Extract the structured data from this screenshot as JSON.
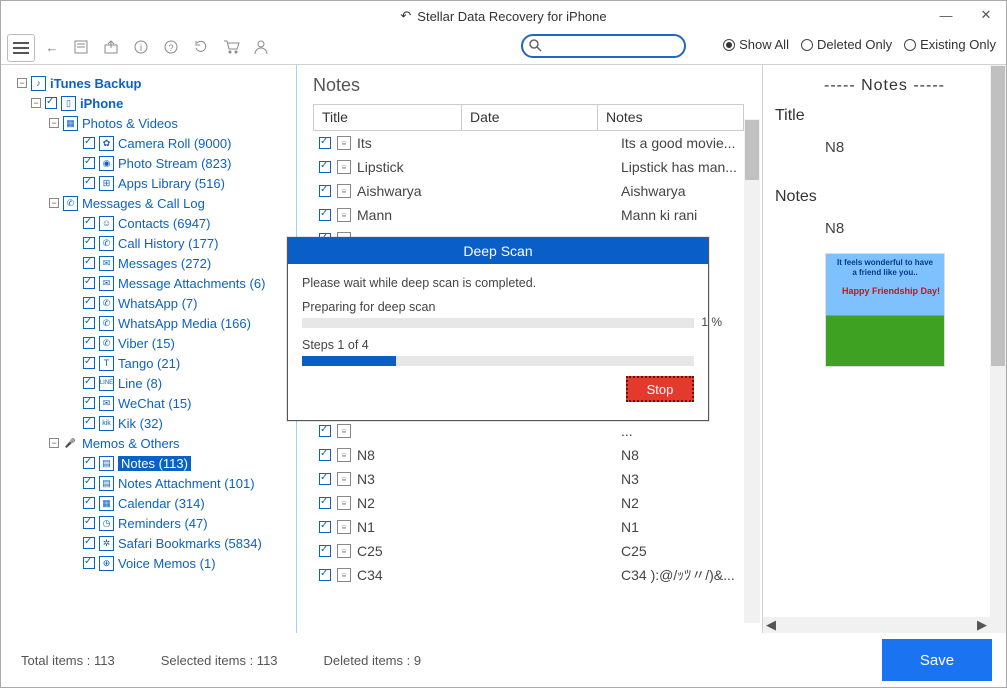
{
  "window": {
    "title": "Stellar Data Recovery for iPhone"
  },
  "filter": {
    "show_all": "Show All",
    "deleted_only": "Deleted Only",
    "existing_only": "Existing Only"
  },
  "tree": {
    "root": "iTunes Backup",
    "device": "iPhone",
    "groups": [
      {
        "label": "Photos & Videos",
        "children": [
          {
            "label": "Camera Roll (9000)"
          },
          {
            "label": "Photo Stream (823)"
          },
          {
            "label": "Apps Library (516)"
          }
        ]
      },
      {
        "label": "Messages & Call Log",
        "children": [
          {
            "label": "Contacts (6947)"
          },
          {
            "label": "Call History (177)"
          },
          {
            "label": "Messages (272)"
          },
          {
            "label": "Message Attachments (6)"
          },
          {
            "label": "WhatsApp (7)"
          },
          {
            "label": "WhatsApp Media (166)"
          },
          {
            "label": "Viber (15)"
          },
          {
            "label": "Tango (21)"
          },
          {
            "label": "Line (8)"
          },
          {
            "label": "WeChat (15)"
          },
          {
            "label": "Kik (32)"
          }
        ]
      },
      {
        "label": "Memos & Others",
        "children": [
          {
            "label": "Notes (113)",
            "selected": true
          },
          {
            "label": "Notes Attachment (101)"
          },
          {
            "label": "Calendar (314)"
          },
          {
            "label": "Reminders (47)"
          },
          {
            "label": "Safari Bookmarks (5834)"
          },
          {
            "label": "Voice Memos (1)"
          }
        ]
      }
    ]
  },
  "center": {
    "heading": "Notes",
    "columns": {
      "title": "Title",
      "date": "Date",
      "notes": "Notes"
    },
    "rows": [
      {
        "title": "Its",
        "date": "",
        "notes": "Its a good movie..."
      },
      {
        "title": "Lipstick",
        "date": "",
        "notes": "Lipstick has man..."
      },
      {
        "title": "Aishwarya",
        "date": "",
        "notes": "Aishwarya"
      },
      {
        "title": "Mann",
        "date": "",
        "notes": "Mann ki rani"
      },
      {
        "title": "",
        "date": "",
        "notes": ""
      },
      {
        "title": "",
        "date": "",
        "notes": ""
      },
      {
        "title": "",
        "date": "",
        "notes": ""
      },
      {
        "title": "",
        "date": "",
        "notes": ""
      },
      {
        "title": "",
        "date": "",
        "notes": "."
      },
      {
        "title": "",
        "date": "",
        "notes": ")..."
      },
      {
        "title": "",
        "date": "",
        "notes": ""
      },
      {
        "title": "",
        "date": "",
        "notes": ""
      },
      {
        "title": "",
        "date": "",
        "notes": "..."
      },
      {
        "title": "N8",
        "date": "",
        "notes": "N8"
      },
      {
        "title": "N3",
        "date": "",
        "notes": "N3"
      },
      {
        "title": "N2",
        "date": "",
        "notes": "N2"
      },
      {
        "title": "N1",
        "date": "",
        "notes": "N1"
      },
      {
        "title": "C25",
        "date": "",
        "notes": "C25"
      },
      {
        "title": "C34",
        "date": "",
        "notes": "C34 ):@/ｯﾂ〃/)&..."
      }
    ]
  },
  "preview": {
    "header": "-----  Notes  -----",
    "title_label": "Title",
    "title_value": "N8",
    "notes_label": "Notes",
    "notes_value": "N8",
    "image_line1": "It feels wonderful to have",
    "image_line2": "a friend like you..",
    "image_line3": "Happy Friendship Day!"
  },
  "modal": {
    "title": "Deep Scan",
    "msg": "Please wait while deep scan is completed.",
    "sub": "Preparing for deep scan",
    "pct": "1 %",
    "steps": "Steps 1 of 4",
    "stop": "Stop"
  },
  "footer": {
    "total": "Total items : 113",
    "selected": "Selected items : 113",
    "deleted": "Deleted items : 9",
    "save": "Save"
  }
}
